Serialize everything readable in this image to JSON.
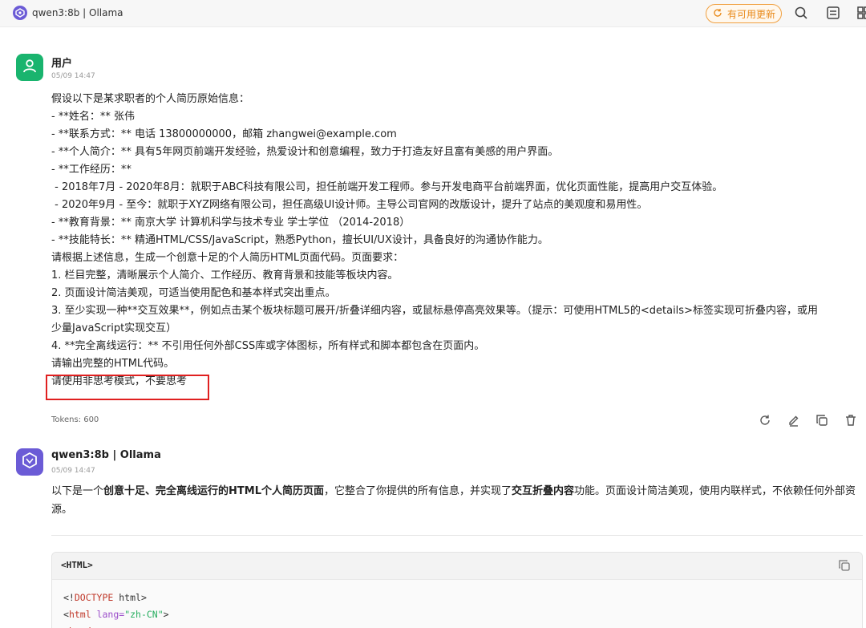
{
  "window": {
    "title": "qwen3:8b | Ollama",
    "update_button": "有可用更新"
  },
  "user_message": {
    "name": "用户",
    "time": "05/09 14:47",
    "lines": [
      "假设以下是某求职者的个人简历原始信息：",
      "- **姓名：** 张伟",
      "- **联系方式：** 电话 13800000000，邮箱 zhangwei@example.com",
      "- **个人简介：** 具有5年网页前端开发经验，热爱设计和创意编程，致力于打造友好且富有美感的用户界面。",
      "- **工作经历：**",
      " - 2018年7月 - 2020年8月：就职于ABC科技有限公司，担任前端开发工程师。参与开发电商平台前端界面，优化页面性能，提高用户交互体验。",
      " - 2020年9月 - 至今：就职于XYZ网络有限公司，担任高级UI设计师。主导公司官网的改版设计，提升了站点的美观度和易用性。",
      "- **教育背景：** 南京大学 计算机科学与技术专业 学士学位 （2014-2018）",
      "- **技能特长：** 精通HTML/CSS/JavaScript，熟悉Python，擅长UI/UX设计，具备良好的沟通协作能力。",
      "请根据上述信息，生成一个创意十足的个人简历HTML页面代码。页面要求：",
      "1. 栏目完整，清晰展示个人简介、工作经历、教育背景和技能等板块内容。",
      "2. 页面设计简洁美观，可适当使用配色和基本样式突出重点。",
      "3. 至少实现一种**交互效果**，例如点击某个板块标题可展开/折叠详细内容，或鼠标悬停高亮效果等。（提示：可使用HTML5的<details>标签实现可折叠内容，或用",
      "少量JavaScript实现交互）",
      "4. **完全离线运行：** 不引用任何外部CSS库或字体图标，所有样式和脚本都包含在页面内。",
      "请输出完整的HTML代码。",
      "请使用非思考模式，不要思考"
    ],
    "tokens": "Tokens: 600"
  },
  "assistant_message": {
    "name": "qwen3:8b | Ollama",
    "time": "05/09 14:47",
    "reply": {
      "p1": "以下是一个",
      "b1": "创意十足、完全离线运行的HTML个人简历页面",
      "p2": "，它整合了你提供的所有信息，并实现了",
      "b2": "交互折叠内容",
      "p3": "功能。页面设计简洁美观，使用内联样式，不依赖任何外部资源。"
    },
    "code": {
      "lang": "<HTML>",
      "line1_open": "<!",
      "line1_tag": "DOCTYPE",
      "line1_rest": " html>",
      "line2_open": "<",
      "line2_tag": "html",
      "line2_attr": " lang=",
      "line2_value": "\"zh-CN\"",
      "line2_close": ">",
      "line3_open": "<",
      "line3_tag": "head",
      "line3_close": ">"
    }
  },
  "colors": {
    "user_avatar": "#19b46e",
    "assistant_avatar": "#6b5bd6",
    "update_accent": "#e98a1a",
    "highlight": "#e02020"
  },
  "icons": [
    "app-logo-icon",
    "refresh-icon",
    "search-icon",
    "split-view-icon",
    "grid-icon",
    "user-icon",
    "regenerate-icon",
    "edit-icon",
    "copy-icon",
    "delete-icon",
    "assistant-logo-icon",
    "copy-code-icon"
  ]
}
